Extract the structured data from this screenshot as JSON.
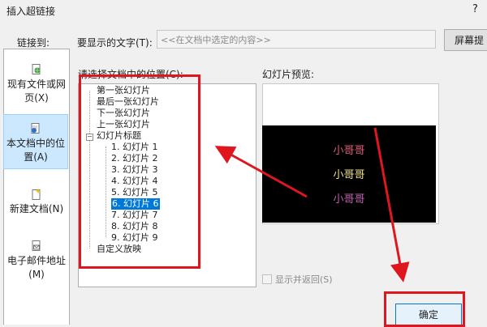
{
  "window": {
    "title": "插入超链接",
    "help": "?"
  },
  "link_to": {
    "label": "链接到:",
    "items": [
      {
        "line1": "现有文件或网",
        "line2": "页(X)",
        "icon": "globe-file-icon"
      },
      {
        "line1": "本文档中的位",
        "line2": "置(A)",
        "icon": "document-place-icon",
        "selected": true
      },
      {
        "line1": "新建文档(N)",
        "line2": "",
        "icon": "new-document-icon"
      },
      {
        "line1": "电子邮件地址",
        "line2": "(M)",
        "icon": "email-icon"
      }
    ]
  },
  "display_text": {
    "label": "要显示的文字(T):",
    "value": "<<在文档中选定的内容>>",
    "tip_button": "屏幕提"
  },
  "place": {
    "label": "请选择文档中的位置(C):",
    "tree": {
      "top": [
        "第一张幻灯片",
        "最后一张幻灯片",
        "下一张幻灯片",
        "上一张幻灯片"
      ],
      "group": "幻灯片标题",
      "children": [
        "1. 幻灯片 1",
        "2. 幻灯片 2",
        "3. 幻灯片 3",
        "4. 幻灯片 4",
        "5. 幻灯片 5",
        "6. 幻灯片 6",
        "7. 幻灯片 7",
        "8. 幻灯片 8",
        "9. 幻灯片 9"
      ],
      "selected_child": 5,
      "bottom": "自定义放映",
      "expander": "−"
    }
  },
  "preview": {
    "label": "幻灯片预览:",
    "lines": [
      {
        "text": "小哥哥",
        "color": "#e05a7a"
      },
      {
        "text": "小哥哥",
        "color": "#f0e08a"
      },
      {
        "text": "小哥哥",
        "color": "#c060b0"
      }
    ]
  },
  "show_return": {
    "label": "显示并返回(S)",
    "checked": false
  },
  "ok_button": {
    "label": "确定"
  },
  "colors": {
    "annotation_red": "#e0161f",
    "selection_blue": "#0078d7"
  }
}
